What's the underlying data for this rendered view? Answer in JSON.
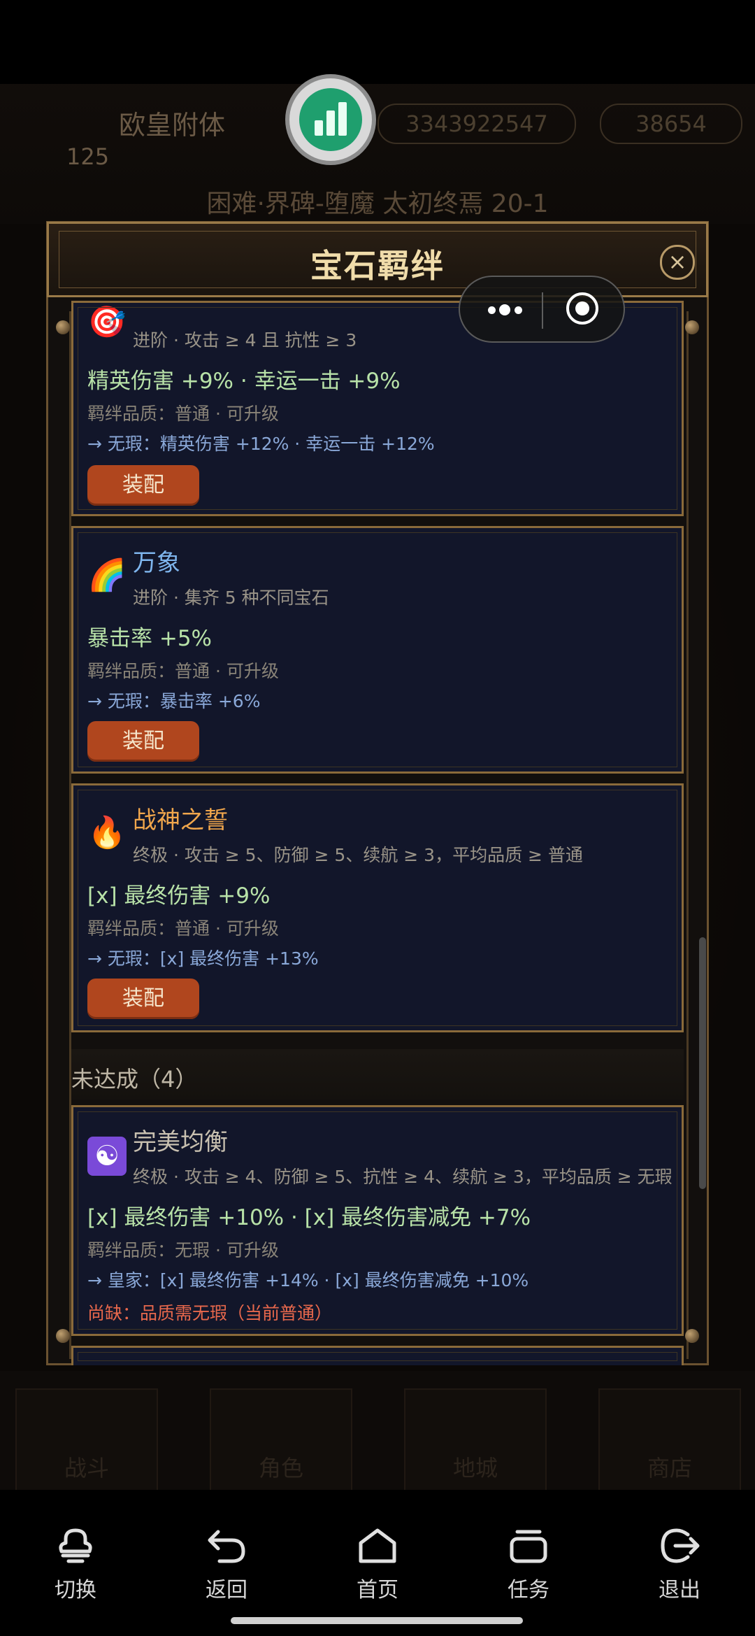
{
  "background": {
    "player_name": "欧皇附体",
    "player_level": "125",
    "currency_1": "3343922547",
    "currency_2": "38654",
    "stage": "困难·界碑-堕魔 太初终焉 20-1",
    "nav": [
      "战斗",
      "角色",
      "地城",
      "商店"
    ]
  },
  "modal": {
    "title": "宝石羁绊",
    "cards": [
      {
        "icon": "target-icon",
        "glyph": "🎯",
        "name": "",
        "requirement": "进阶 · 攻击 ≥ 4 且 抗性 ≥ 3",
        "effect": "精英伤害 +9% · 幸运一击 +9%",
        "quality": "羁绊品质：普通 · 可升级",
        "upgrade": "→ 无瑕：精英伤害 +12% · 幸运一击 +12%",
        "button": "装配"
      },
      {
        "icon": "rainbow-icon",
        "glyph": "🌈",
        "name": "万象",
        "requirement": "进阶 · 集齐 5 种不同宝石",
        "effect": "暴击率 +5%",
        "quality": "羁绊品质：普通 · 可升级",
        "upgrade": "→ 无瑕：暴击率 +6%",
        "button": "装配"
      },
      {
        "icon": "fire-icon",
        "glyph": "🔥",
        "name": "战神之誓",
        "requirement": "终极 · 攻击 ≥ 5、防御 ≥ 5、续航 ≥ 3，平均品质 ≥ 普通",
        "effect": "[x] 最终伤害 +9%",
        "quality": "羁绊品质：普通 · 可升级",
        "upgrade": "→ 无瑕：[x] 最终伤害 +13%",
        "button": "装配"
      }
    ],
    "section_unmet": "未达成（4）",
    "unmet_card": {
      "icon": "yin-yang-icon",
      "glyph": "☯",
      "name": "完美均衡",
      "requirement": "终极 · 攻击 ≥ 4、防御 ≥ 5、抗性 ≥ 4、续航 ≥ 3，平均品质 ≥ 无瑕",
      "effect": "[x] 最终伤害 +10% · [x] 最终伤害减免 +7%",
      "quality": "羁绊品质：无瑕 · 可升级",
      "upgrade": "→ 皇家：[x] 最终伤害 +14% · [x] 最终伤害减免 +10%",
      "missing": "尚缺：品质需无瑕（当前普通）"
    }
  },
  "system_nav": {
    "switch": "切换",
    "back": "返回",
    "home": "首页",
    "tasks": "任务",
    "exit": "退出"
  }
}
